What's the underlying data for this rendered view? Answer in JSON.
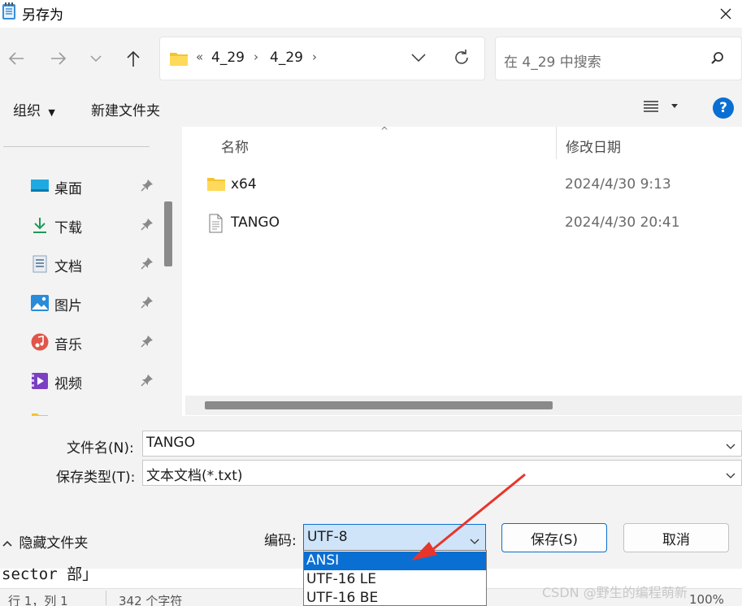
{
  "window": {
    "title": "另存为"
  },
  "address": {
    "overflow": "«",
    "seg1": "4_29",
    "seg2": "4_29"
  },
  "search": {
    "placeholder": "在 4_29 中搜索"
  },
  "toolbar": {
    "organize": "组织",
    "new_folder": "新建文件夹"
  },
  "sidebar": {
    "items": [
      {
        "label": "桌面",
        "icon": "desktop-icon"
      },
      {
        "label": "下载",
        "icon": "download-icon"
      },
      {
        "label": "文档",
        "icon": "document-icon"
      },
      {
        "label": "图片",
        "icon": "pictures-icon"
      },
      {
        "label": "音乐",
        "icon": "music-icon"
      },
      {
        "label": "视频",
        "icon": "video-icon"
      }
    ]
  },
  "files": {
    "columns": {
      "name": "名称",
      "date": "修改日期"
    },
    "rows": [
      {
        "name": "x64",
        "date": "2024/4/30 9:13",
        "type": "folder"
      },
      {
        "name": "TANGO",
        "date": "2024/4/30 20:41",
        "type": "file"
      }
    ]
  },
  "form": {
    "filename_label": "文件名(N):",
    "filename_value": "TANGO",
    "filetype_label": "保存类型(T):",
    "filetype_value": "文本文档(*.txt)"
  },
  "footer": {
    "hide_folders": "隐藏文件夹",
    "encoding_label": "编码:",
    "encoding_value": "UTF-8",
    "save": "保存(S)",
    "cancel": "取消"
  },
  "encoding_options": [
    "ANSI",
    "UTF-16 LE",
    "UTF-16 BE"
  ],
  "background_editor": {
    "code": "sector 部」",
    "status_pos": "行 1，列 1",
    "status_chars": "342 个字符",
    "status_zoom": "100%"
  },
  "watermark": "CSDN @野生的编程萌新",
  "colors": {
    "accent": "#0a6fd3",
    "annotation_arrow": "#e8352b"
  }
}
